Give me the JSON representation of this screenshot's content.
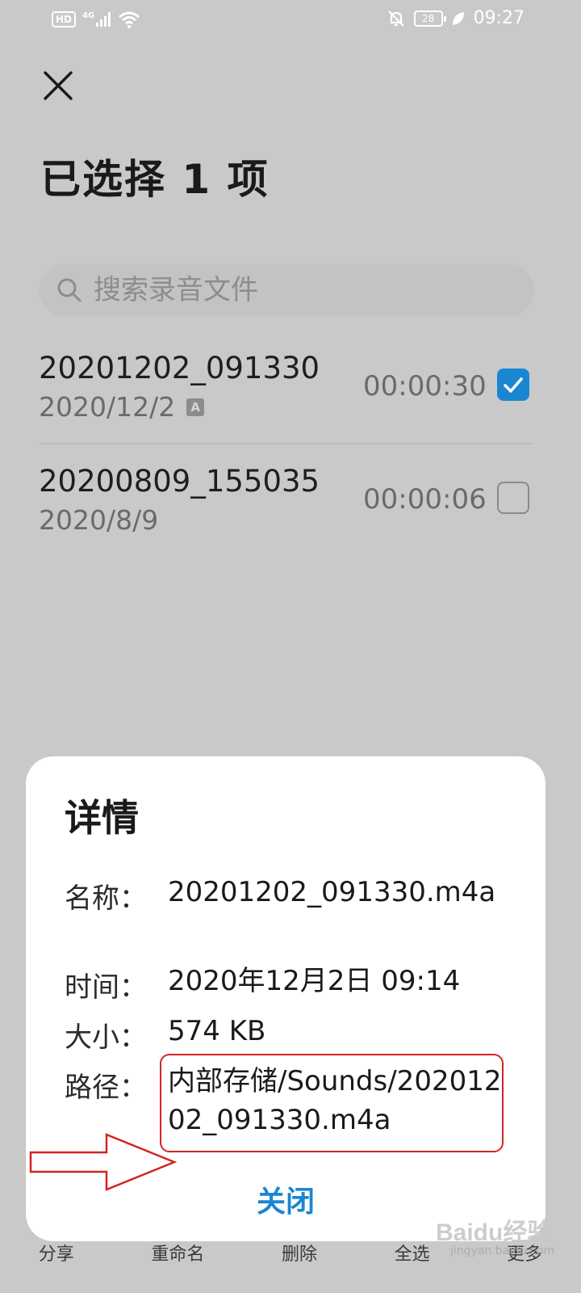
{
  "status_bar": {
    "hd": "HD",
    "network": "4G",
    "battery": "28",
    "time": "09:27"
  },
  "header": {
    "title": "已选择 1 项"
  },
  "search": {
    "placeholder": "搜索录音文件"
  },
  "recordings": [
    {
      "name": "20201202_091330",
      "date": "2020/12/2",
      "badge": "A",
      "duration": "00:00:30",
      "checked": true
    },
    {
      "name": "20200809_155035",
      "date": "2020/8/9",
      "duration": "00:00:06",
      "checked": false
    }
  ],
  "toolbar": {
    "share": "分享",
    "rename": "重命名",
    "delete": "删除",
    "select_all": "全选",
    "more": "更多"
  },
  "dialog": {
    "title": "详情",
    "name_label": "名称：",
    "name_value": "20201202_091330.m4a",
    "time_label": "时间：",
    "time_value": "2020年12月2日 09:14",
    "size_label": "大小：",
    "size_value": "574 KB",
    "path_label": "路径：",
    "path_value": "内部存储/Sounds/20201202_091330.m4a",
    "close_label": "关闭"
  },
  "watermark": {
    "brand": "Baidu经验",
    "site": "jingyan.baidu.com"
  },
  "colors": {
    "accent": "#1a86d2",
    "annotation": "#d32323",
    "dim_background": "#c9c9c9"
  }
}
